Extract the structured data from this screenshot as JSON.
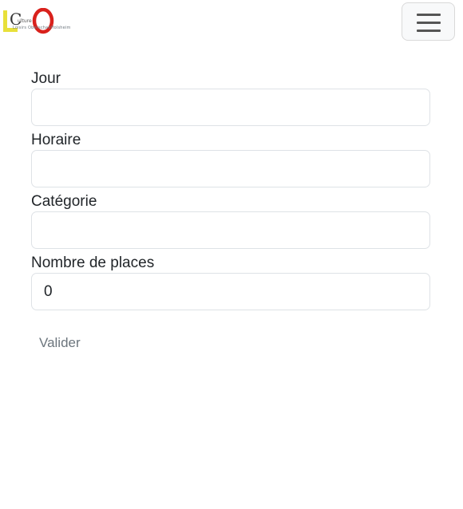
{
  "brand": {
    "logo_lettering": "LCO Culture Loisirs Oberschaeffolsheim",
    "tagline": "Loisirs Oberschaeffolsheim",
    "colors": {
      "yellow": "#e8e03a",
      "red": "#d9211c",
      "dark": "#333333"
    }
  },
  "navbar": {
    "menu_icon": "hamburger-icon"
  },
  "form": {
    "fields": [
      {
        "label": "Jour",
        "value": ""
      },
      {
        "label": "Horaire",
        "value": ""
      },
      {
        "label": "Catégorie",
        "value": ""
      },
      {
        "label": "Nombre de places",
        "value": "0"
      }
    ],
    "submit_label": "Valider"
  }
}
